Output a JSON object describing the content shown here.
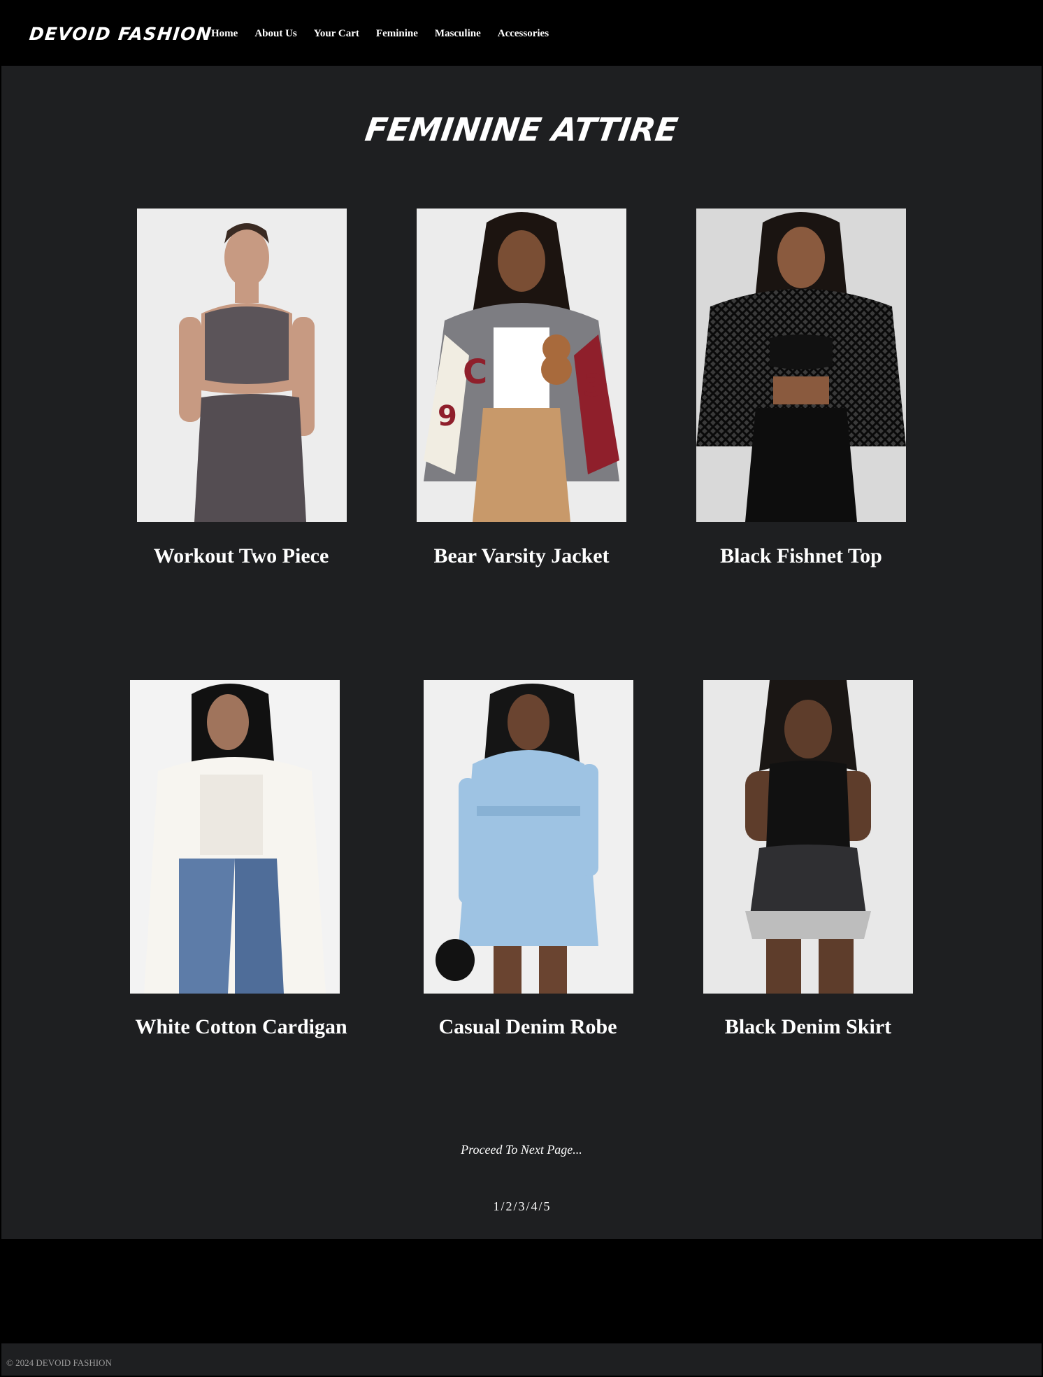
{
  "header": {
    "logo": "DEVOID FASHION",
    "nav": [
      "Home",
      "About Us",
      "Your Cart",
      "Feminine",
      "Masculine",
      "Accessories"
    ]
  },
  "main": {
    "title": "FEMININE ATTIRE",
    "products": [
      {
        "name": "Workout Two Piece"
      },
      {
        "name": "Bear Varsity Jacket"
      },
      {
        "name": "Black Fishnet Top"
      },
      {
        "name": "White Cotton Cardigan"
      },
      {
        "name": "Casual Denim Robe"
      },
      {
        "name": "Black Denim Skirt"
      }
    ],
    "pager_note": "Proceed To Next Page...",
    "pages": [
      "1",
      "2",
      "3",
      "4",
      "5"
    ]
  },
  "footer": {
    "copyright": "© 2024 DEVOID FASHION"
  }
}
